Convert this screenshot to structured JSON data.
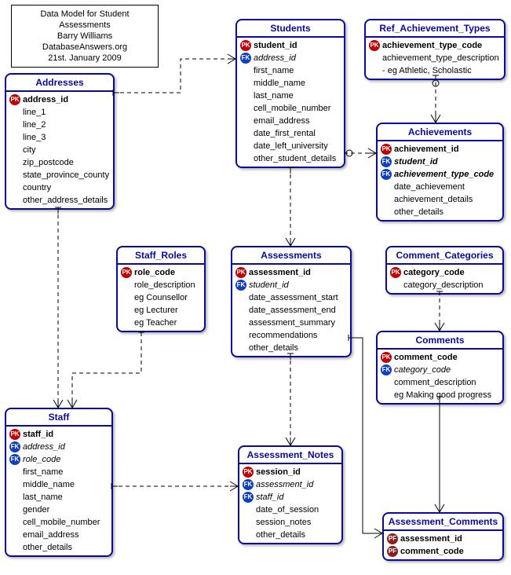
{
  "title": {
    "l1": "Data Model for Student Assessments",
    "l2": "Barry Williams",
    "l3": "DatabaseAnswers.org",
    "l4": "21st. January 2009"
  },
  "addresses": {
    "name": "Addresses",
    "f": [
      "address_id",
      "line_1",
      "line_2",
      "line_3",
      "city",
      "zip_postcode",
      "state_province_county",
      "country",
      "other_address_details"
    ]
  },
  "students": {
    "name": "Students",
    "f": [
      "student_id",
      "address_id",
      "first_name",
      "middle_name",
      "last_name",
      "cell_mobile_number",
      "email_address",
      "date_first_rental",
      "date_left_university",
      "other_student_details"
    ]
  },
  "ref_ach": {
    "name": "Ref_Achievement_Types",
    "f": [
      "achievement_type_code",
      "achievement_type_description",
      "- eg Athletic, Scholastic"
    ]
  },
  "achievements": {
    "name": "Achievements",
    "f": [
      "achievement_id",
      "student_id",
      "achievement_type_code",
      "date_achievement",
      "achievement_details",
      "other_details"
    ]
  },
  "staff_roles": {
    "name": "Staff_Roles",
    "f": [
      "role_code",
      "role_description",
      "eg Counsellor",
      "eg Lecturer",
      "eg Teacher"
    ]
  },
  "assessments": {
    "name": "Assessments",
    "f": [
      "assessment_id",
      "student_id",
      "date_assessment_start",
      "date_assessment_end",
      "assessment_summary",
      "recommendations",
      "other_details"
    ]
  },
  "comment_cat": {
    "name": "Comment_Categories",
    "f": [
      "category_code",
      "category_description"
    ]
  },
  "comments": {
    "name": "Comments",
    "f": [
      "comment_code",
      "category_code",
      "comment_description",
      "eg Making good progress"
    ]
  },
  "staff": {
    "name": "Staff",
    "f": [
      "staff_id",
      "address_id",
      "role_code",
      "first_name",
      "middle_name",
      "last_name",
      "gender",
      "cell_mobile_number",
      "email_address",
      "other_details"
    ]
  },
  "assess_notes": {
    "name": "Assessment_Notes",
    "f": [
      "session_id",
      "assessment_id",
      "staff_id",
      "date_of_session",
      "session_notes",
      "other_details"
    ]
  },
  "assess_comm": {
    "name": "Assessment_Comments",
    "f": [
      "assessment_id",
      "comment_code"
    ]
  },
  "chart_data": {
    "type": "er-diagram",
    "entities": [
      {
        "name": "Addresses",
        "pk": [
          "address_id"
        ],
        "attrs": [
          "line_1",
          "line_2",
          "line_3",
          "city",
          "zip_postcode",
          "state_province_county",
          "country",
          "other_address_details"
        ]
      },
      {
        "name": "Students",
        "pk": [
          "student_id"
        ],
        "fk": [
          "address_id"
        ],
        "attrs": [
          "first_name",
          "middle_name",
          "last_name",
          "cell_mobile_number",
          "email_address",
          "date_first_rental",
          "date_left_university",
          "other_student_details"
        ]
      },
      {
        "name": "Ref_Achievement_Types",
        "pk": [
          "achievement_type_code"
        ],
        "attrs": [
          "achievement_type_description",
          "- eg Athletic, Scholastic"
        ]
      },
      {
        "name": "Achievements",
        "pk": [
          "achievement_id"
        ],
        "fk": [
          "student_id",
          "achievement_type_code"
        ],
        "attrs": [
          "date_achievement",
          "achievement_details",
          "other_details"
        ]
      },
      {
        "name": "Staff_Roles",
        "pk": [
          "role_code"
        ],
        "attrs": [
          "role_description",
          "eg Counsellor",
          "eg Lecturer",
          "eg Teacher"
        ]
      },
      {
        "name": "Assessments",
        "pk": [
          "assessment_id"
        ],
        "fk": [
          "student_id"
        ],
        "attrs": [
          "date_assessment_start",
          "date_assessment_end",
          "assessment_summary",
          "recommendations",
          "other_details"
        ]
      },
      {
        "name": "Comment_Categories",
        "pk": [
          "category_code"
        ],
        "attrs": [
          "category_description"
        ]
      },
      {
        "name": "Comments",
        "pk": [
          "comment_code"
        ],
        "fk": [
          "category_code"
        ],
        "attrs": [
          "comment_description",
          "eg Making good progress"
        ]
      },
      {
        "name": "Staff",
        "pk": [
          "staff_id"
        ],
        "fk": [
          "address_id",
          "role_code"
        ],
        "attrs": [
          "first_name",
          "middle_name",
          "last_name",
          "gender",
          "cell_mobile_number",
          "email_address",
          "other_details"
        ]
      },
      {
        "name": "Assessment_Notes",
        "pk": [
          "session_id"
        ],
        "fk": [
          "assessment_id",
          "staff_id"
        ],
        "attrs": [
          "date_of_session",
          "session_notes",
          "other_details"
        ]
      },
      {
        "name": "Assessment_Comments",
        "pfk": [
          "assessment_id",
          "comment_code"
        ]
      }
    ],
    "relationships": [
      {
        "from": "Addresses",
        "to": "Students",
        "via": "address_id"
      },
      {
        "from": "Addresses",
        "to": "Staff",
        "via": "address_id"
      },
      {
        "from": "Students",
        "to": "Achievements",
        "via": "student_id"
      },
      {
        "from": "Ref_Achievement_Types",
        "to": "Achievements",
        "via": "achievement_type_code"
      },
      {
        "from": "Students",
        "to": "Assessments",
        "via": "student_id"
      },
      {
        "from": "Staff_Roles",
        "to": "Staff",
        "via": "role_code"
      },
      {
        "from": "Assessments",
        "to": "Assessment_Notes",
        "via": "assessment_id"
      },
      {
        "from": "Staff",
        "to": "Assessment_Notes",
        "via": "staff_id"
      },
      {
        "from": "Comment_Categories",
        "to": "Comments",
        "via": "category_code"
      },
      {
        "from": "Comments",
        "to": "Assessment_Comments",
        "via": "comment_code"
      },
      {
        "from": "Assessments",
        "to": "Assessment_Comments",
        "via": "assessment_id"
      }
    ]
  }
}
